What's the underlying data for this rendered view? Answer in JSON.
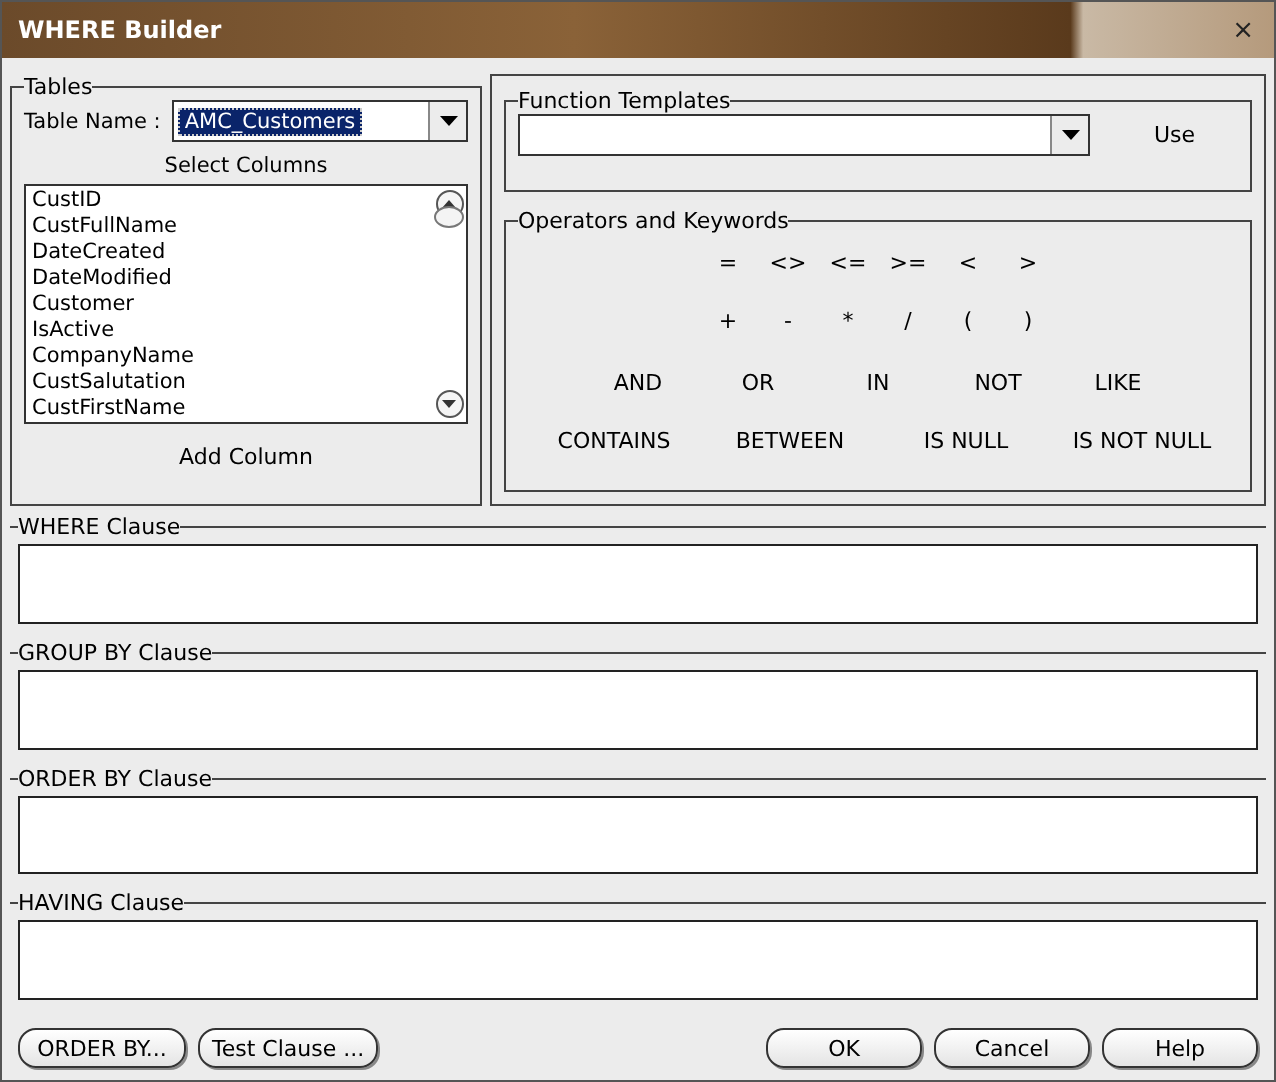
{
  "window": {
    "title": "WHERE Builder",
    "close": "×"
  },
  "tables": {
    "legend": "Tables",
    "table_name_label": "Table Name :",
    "table_name": "AMC_Customers",
    "select_columns_label": "Select Columns",
    "columns": [
      "CustID",
      "CustFullName",
      "DateCreated",
      "DateModified",
      "Customer",
      "IsActive",
      "CompanyName",
      "CustSalutation",
      "CustFirstName"
    ],
    "add_button": "Add Column"
  },
  "function_templates": {
    "legend": "Function Templates",
    "use_button": "Use"
  },
  "operators": {
    "legend": "Operators and Keywords",
    "rows": [
      [
        "=",
        "<>",
        "<=",
        ">=",
        "<",
        ">"
      ],
      [
        "+",
        "-",
        "*",
        "/",
        "(",
        ")"
      ]
    ],
    "keyword_rows": [
      [
        "AND",
        "OR",
        "IN",
        "NOT",
        "LIKE"
      ],
      [
        "CONTAINS",
        "BETWEEN",
        "IS NULL",
        "IS NOT NULL"
      ]
    ]
  },
  "clauses": [
    {
      "label": "WHERE Clause"
    },
    {
      "label": "GROUP BY Clause"
    },
    {
      "label": "ORDER BY Clause"
    },
    {
      "label": "HAVING Clause"
    }
  ],
  "left_buttons": [
    "ORDER BY...",
    "Test Clause ..."
  ],
  "right_buttons": [
    "OK",
    "Cancel",
    "Help"
  ]
}
